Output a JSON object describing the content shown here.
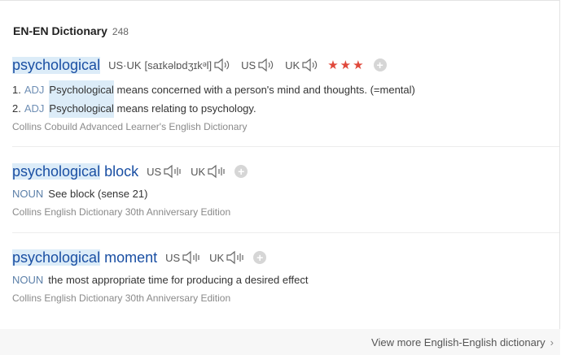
{
  "header": {
    "title": "EN-EN Dictionary",
    "count": "248"
  },
  "entries": [
    {
      "headword": "psychological",
      "pron_combined": "US·UK",
      "ipa": "[saɪkəlɒdʒɪkᵊl]",
      "us_label": "US",
      "uk_label": "UK",
      "stars": "★★★",
      "definitions": [
        {
          "num": "1.",
          "pos": "ADJ",
          "word": "Psychological",
          "rest": "means concerned with a person's mind and thoughts. (=mental)"
        },
        {
          "num": "2.",
          "pos": "ADJ",
          "word": "Psychological",
          "rest": "means relating to psychology."
        }
      ],
      "source": "Collins Cobuild Advanced Learner's English Dictionary"
    },
    {
      "headword_hl": "psychological",
      "headword_rest": "block",
      "us_label": "US",
      "uk_label": "UK",
      "pos": "NOUN",
      "definition": "See block (sense 21)",
      "source": "Collins English Dictionary 30th Anniversary Edition"
    },
    {
      "headword_hl": "psychological",
      "headword_rest": "moment",
      "us_label": "US",
      "uk_label": "UK",
      "pos": "NOUN",
      "definition": "the most appropriate time for producing a desired effect",
      "source": "Collins English Dictionary 30th Anniversary Edition"
    }
  ],
  "footer": {
    "more_link": "View more English-English dictionary",
    "chevron_icon": "chevron-right-icon"
  },
  "icons": {
    "speaker": "speaker-icon",
    "add": "add-icon"
  },
  "colors": {
    "headword": "#1a4fa3",
    "highlight": "#dcecf8",
    "stars": "#e0483b",
    "pos": "#6f8fb5"
  }
}
